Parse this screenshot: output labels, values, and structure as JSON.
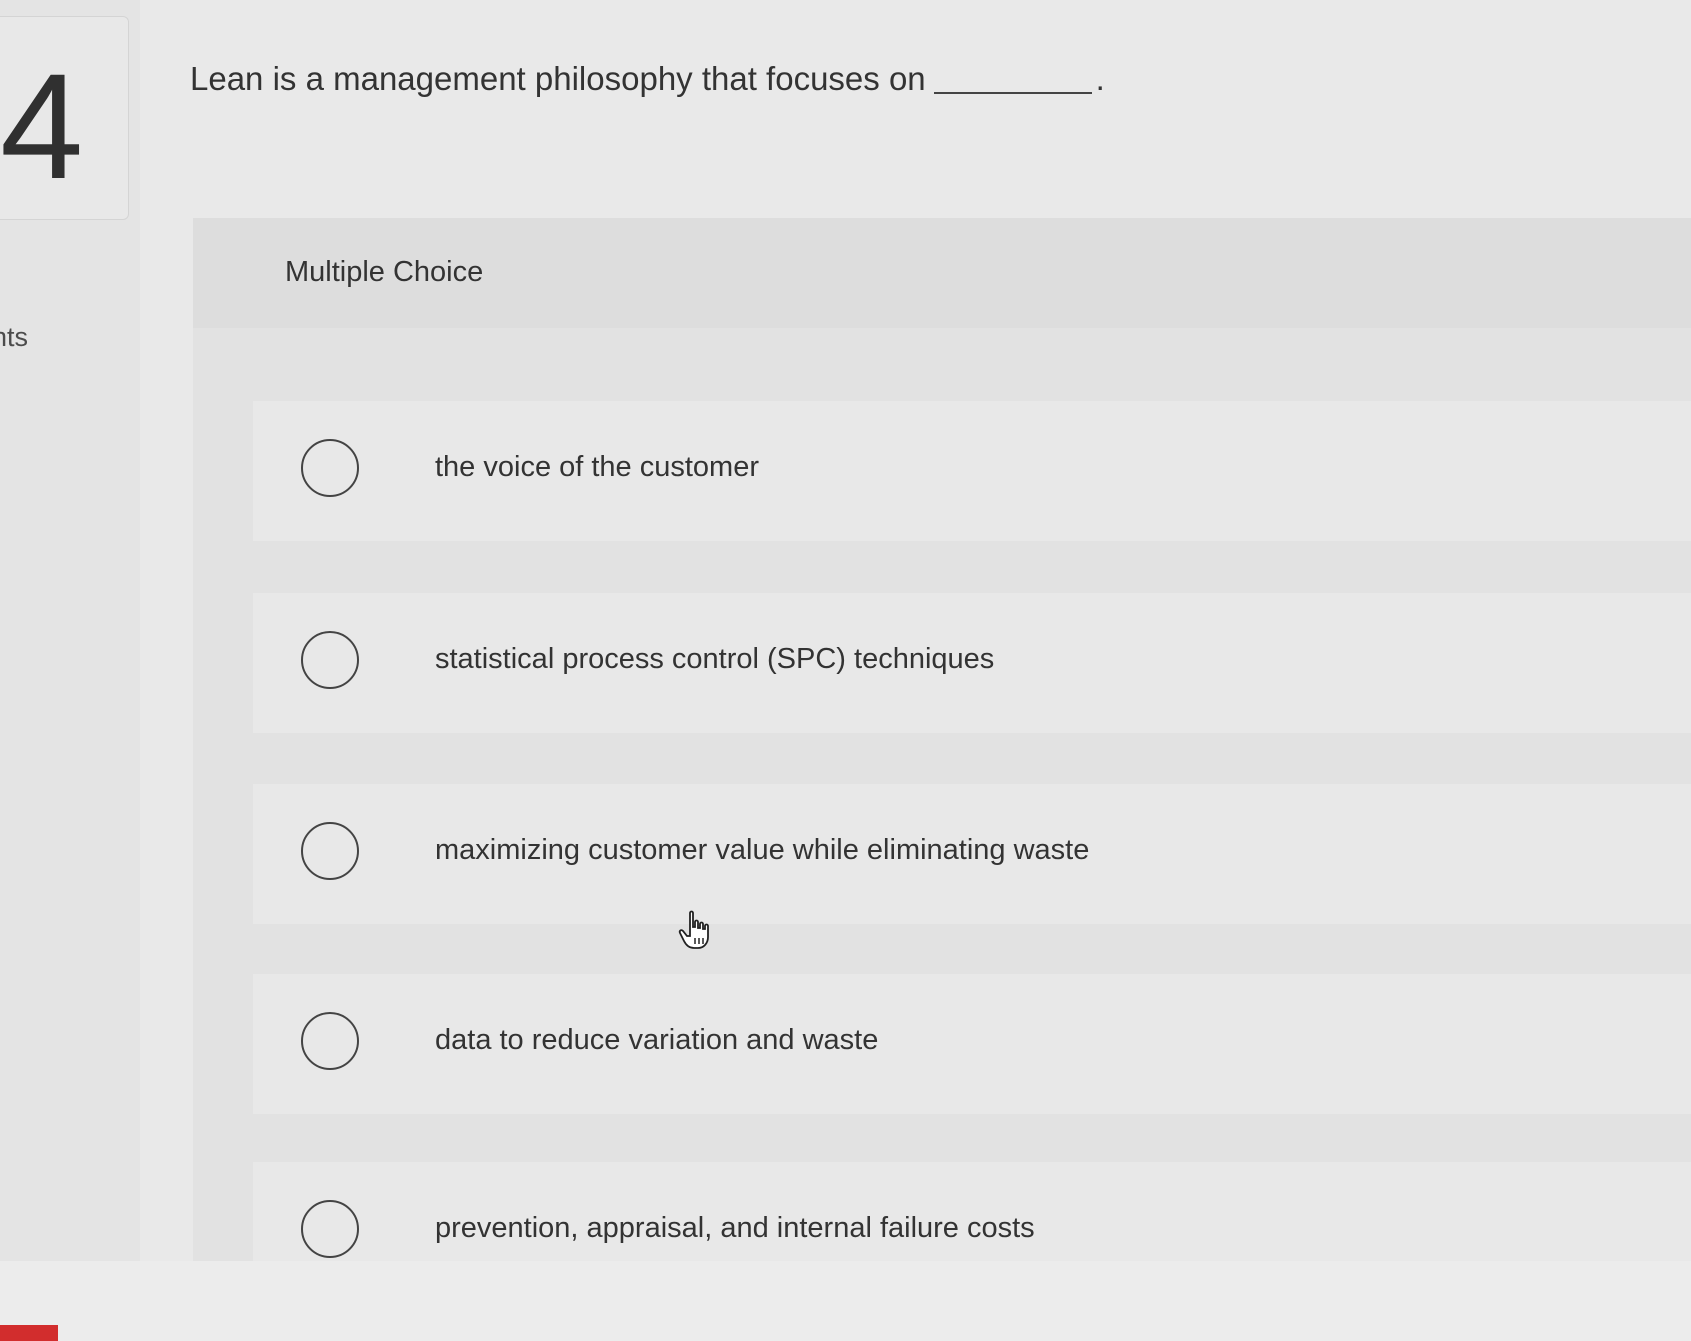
{
  "question": {
    "number": "4",
    "points_label": "nts",
    "text": "Lean is a management philosophy that focuses on",
    "suffix": "."
  },
  "choices": {
    "type_label": "Multiple Choice",
    "options": [
      {
        "label": "the voice of the customer"
      },
      {
        "label": "statistical process control (SPC) techniques"
      },
      {
        "label": "maximizing customer value while eliminating waste"
      },
      {
        "label": "data to reduce variation and waste"
      },
      {
        "label": "prevention, appraisal, and internal failure costs"
      }
    ]
  },
  "cursor": {
    "icon": "hand-pointer-icon"
  },
  "colors": {
    "background": "#e9e9e9",
    "panel": "#e2e2e2",
    "option_row": "#e8e8e8",
    "text": "#333333",
    "accent_red": "#d22d2d"
  }
}
